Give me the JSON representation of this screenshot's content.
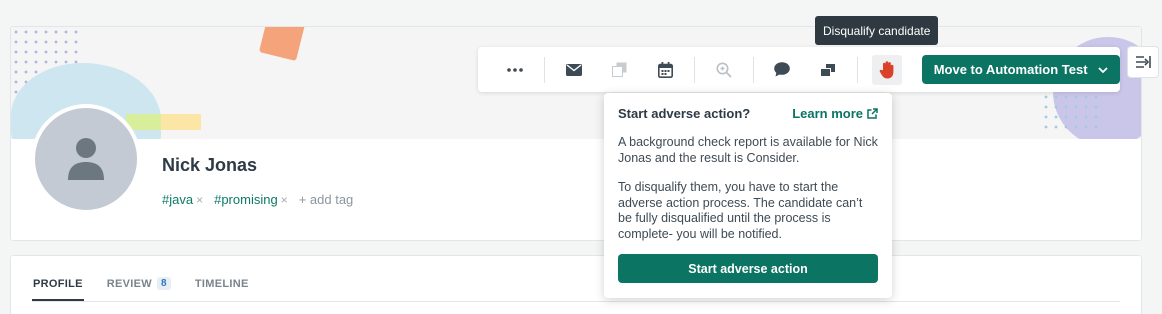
{
  "candidate": {
    "name": "Nick Jonas",
    "tags": [
      "#java",
      "#promising"
    ],
    "tag_remove": "×",
    "add_tag_label": "+ add tag"
  },
  "toolbar": {
    "icons": [
      "more-icon",
      "email-icon",
      "copy-icon",
      "calendar-icon",
      "search-icon",
      "comment-icon",
      "move-icon",
      "disqualify-hand-icon"
    ],
    "move_button_label": "Move to Automation Test"
  },
  "tooltip": {
    "text": "Disqualify candidate"
  },
  "popover": {
    "title": "Start adverse action?",
    "learn_more": "Learn more",
    "paragraph1": "A background check report is available for Nick Jonas and the result is Consider.",
    "paragraph2": "To disqualify them, you have to start the adverse action process. The candidate can’t be fully disqualified until the process is complete- you will be notified.",
    "button_label": "Start adverse action"
  },
  "tabs": [
    {
      "label": "PROFILE",
      "active": true
    },
    {
      "label": "REVIEW",
      "badge": "8"
    },
    {
      "label": "TIMELINE"
    }
  ],
  "colors": {
    "accent": "#0b7463",
    "hand": "#d9412b",
    "tooltip_bg": "#2f3941"
  }
}
